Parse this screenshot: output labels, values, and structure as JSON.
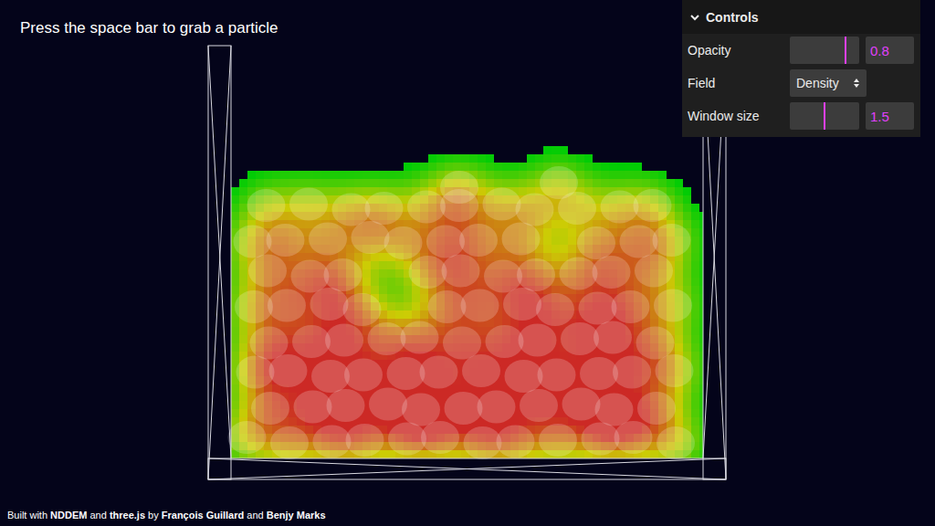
{
  "hint": "Press the space bar to grab a particle",
  "controls": {
    "title": "Controls",
    "expanded": true,
    "rows": [
      {
        "kind": "slider",
        "label": "Opacity",
        "level": 0.8,
        "value": "0.8"
      },
      {
        "kind": "select",
        "label": "Field",
        "value": "Density"
      },
      {
        "kind": "slider",
        "label": "Window size",
        "level": 0.5,
        "value": "1.5"
      }
    ]
  },
  "footer": [
    {
      "text": "Built with ",
      "bold": false
    },
    {
      "text": "NDDEM",
      "bold": true
    },
    {
      "text": " and ",
      "bold": false
    },
    {
      "text": "three.js",
      "bold": true
    },
    {
      "text": " by ",
      "bold": false
    },
    {
      "text": "François Guillard",
      "bold": true
    },
    {
      "text": " and ",
      "bold": false
    },
    {
      "text": "Benjy Marks",
      "bold": true
    }
  ]
}
